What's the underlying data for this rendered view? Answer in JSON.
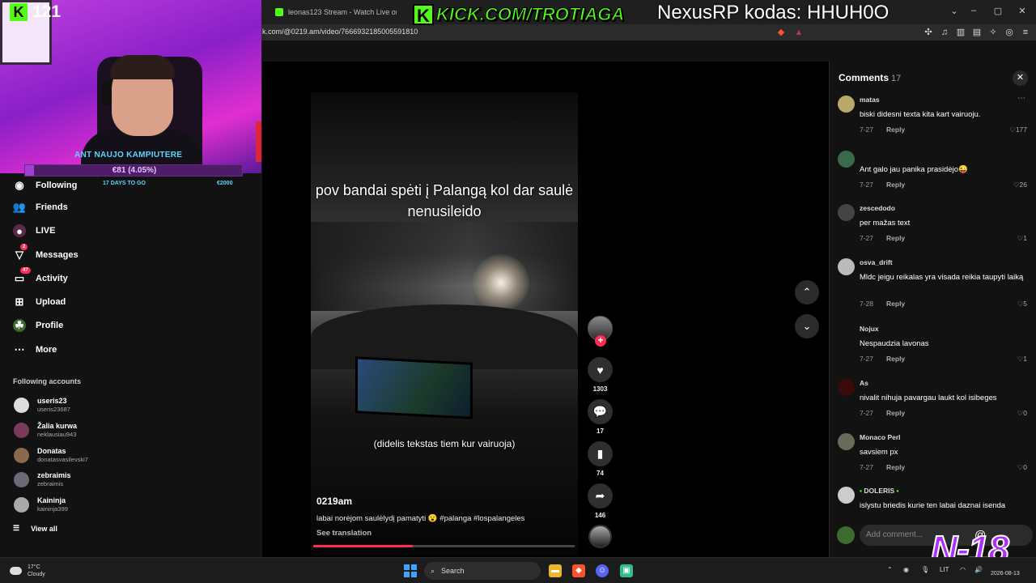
{
  "browser": {
    "tab_title": "leonas123 Stream - Watch Live on Ki",
    "url": "k.com/@0219.am/video/7666932185005591810"
  },
  "stream_overlay": {
    "viewer_count": "121",
    "kick_url": "KICK.COM/TROTIAGA",
    "nexus_text": "NexusRP kodas: HHUH0O",
    "goal_title": "ANT NAUJO KAMPIUTERE",
    "goal_amount": "€81 (4.05%)",
    "goal_progress_pct": 4.05,
    "goal_days": "17 DAYS TO GO",
    "goal_target": "€2000",
    "rating_badge": "N-18",
    "accent_color": "#53fc18"
  },
  "sidebar": {
    "nav": [
      {
        "label": "Following",
        "icon": "following-icon"
      },
      {
        "label": "Friends",
        "icon": "friends-icon"
      },
      {
        "label": "LIVE",
        "icon": "live-icon"
      },
      {
        "label": "Messages",
        "icon": "messages-icon",
        "badge": "2"
      },
      {
        "label": "Activity",
        "icon": "activity-icon",
        "badge": "47"
      },
      {
        "label": "Upload",
        "icon": "upload-icon"
      },
      {
        "label": "Profile",
        "icon": "profile-icon"
      },
      {
        "label": "More",
        "icon": "more-icon"
      }
    ],
    "following_header": "Following accounts",
    "accounts": [
      {
        "name": "useris23",
        "handle": "useris23687"
      },
      {
        "name": "Žalia kurwa",
        "handle": "neklausiau943"
      },
      {
        "name": "Donatas",
        "handle": "donatasvasilevski7"
      },
      {
        "name": "zebraimis",
        "handle": "zebraimis"
      },
      {
        "name": "Kaininja",
        "handle": "kaininja399"
      }
    ],
    "view_all": "View all"
  },
  "video": {
    "caption_top": "pov bandai spėti į Palangą kol dar saulė nenusileido",
    "caption_bottom": "(didelis tekstas tiem kur vairuoja)",
    "author": "0219am",
    "description": "labai norėjom saulėlydį pamatyti 😮 #palanga #lospalangeles",
    "see_translation": "See translation",
    "progress_pct": 38,
    "likes": "1303",
    "comments": "17",
    "saves": "74",
    "shares": "146"
  },
  "comments_panel": {
    "title": "Comments",
    "count": "17",
    "add_placeholder": "Add comment...",
    "items": [
      {
        "user": "matas",
        "text": "biski didesni texta kita kart vairuoju.",
        "date": "7-27",
        "reply": "Reply",
        "likes": "177"
      },
      {
        "user": "",
        "text": "Ant galo jau panika prasidėjo😜",
        "date": "7-27",
        "reply": "Reply",
        "likes": "26"
      },
      {
        "user": "zescedodo",
        "text": "per mažas text",
        "date": "7-27",
        "reply": "Reply",
        "likes": "1"
      },
      {
        "user": "osva_drift",
        "text": "Mldc jeigu reikalas yra visada reikia taupyti laiką",
        "date": "7-28",
        "reply": "Reply",
        "likes": "5"
      },
      {
        "user": "Nojux",
        "text": "Nespaudzia lavonas",
        "date": "7-27",
        "reply": "Reply",
        "likes": "1"
      },
      {
        "user": "As",
        "text": "nivalit nihuja pavargau laukt kol isibeges",
        "date": "7-27",
        "reply": "Reply",
        "likes": "0"
      },
      {
        "user": "Monaco Perl",
        "text": "savsiem px",
        "date": "7-27",
        "reply": "Reply",
        "likes": "0"
      },
      {
        "user": "DOLERIS",
        "text": "islystu briedis kurie ten labai daznai isenda",
        "date": "",
        "reply": "",
        "likes": ""
      }
    ]
  },
  "taskbar": {
    "temp": "17°C",
    "weather": "Cloudy",
    "search_label": "Search",
    "lang": "LIT",
    "date": "2026-08-13"
  }
}
